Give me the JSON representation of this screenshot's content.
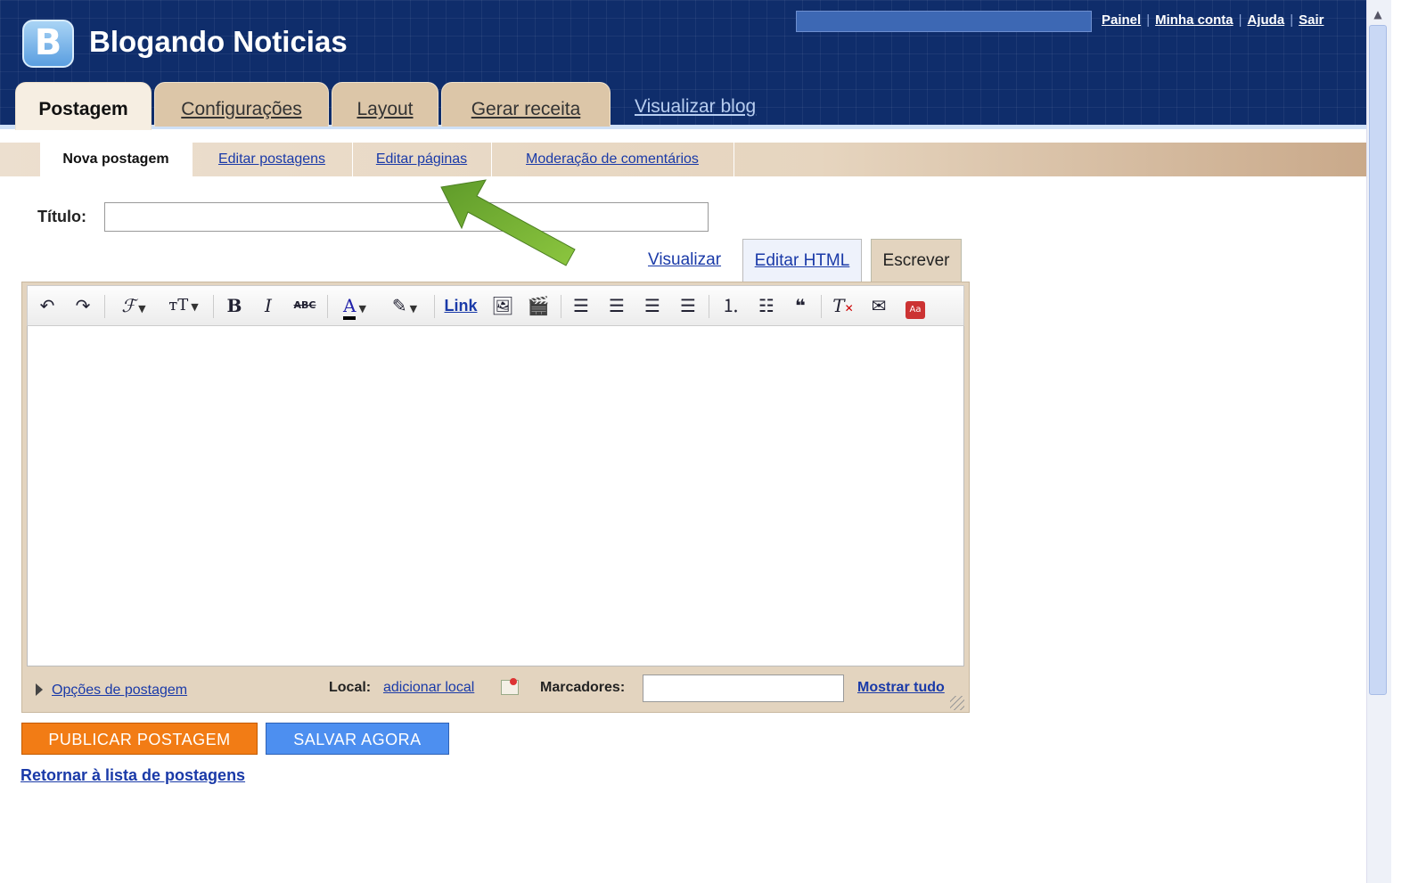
{
  "header": {
    "blog_title": "Blogando Noticias",
    "logo_letter": "B",
    "top_links": [
      "Painel",
      "Minha conta",
      "Ajuda",
      "Sair"
    ],
    "visualizar_blog": "Visualizar blog"
  },
  "tabs": [
    {
      "label": "Postagem",
      "active": true
    },
    {
      "label": "Configurações"
    },
    {
      "label": "Layout"
    },
    {
      "label": "Gerar receita"
    }
  ],
  "subnav": [
    {
      "label": "Nova postagem",
      "active": true
    },
    {
      "label": "Editar postagens"
    },
    {
      "label": "Editar páginas"
    },
    {
      "label": "Moderação de comentários"
    }
  ],
  "editor": {
    "title_label": "Título:",
    "title_value": "",
    "mode_visualizar": "Visualizar",
    "mode_editar_html": "Editar HTML",
    "mode_escrever": "Escrever",
    "toolbar_link": "Link",
    "options_link": "Opções de postagem",
    "local_label": "Local:",
    "local_link": "adicionar local",
    "marcadores_label": "Marcadores:",
    "marcadores_value": "",
    "mostrar_tudo": "Mostrar tudo"
  },
  "buttons": {
    "publish": "PUBLICAR POSTAGEM",
    "save": "SALVAR AGORA",
    "return_link": "Retornar à lista de postagens"
  },
  "colors": {
    "header_bg": "#0f2d6b",
    "publish_btn": "#f27c15",
    "save_btn": "#4d8ff0",
    "annotation_arrow": "#7cb342"
  }
}
